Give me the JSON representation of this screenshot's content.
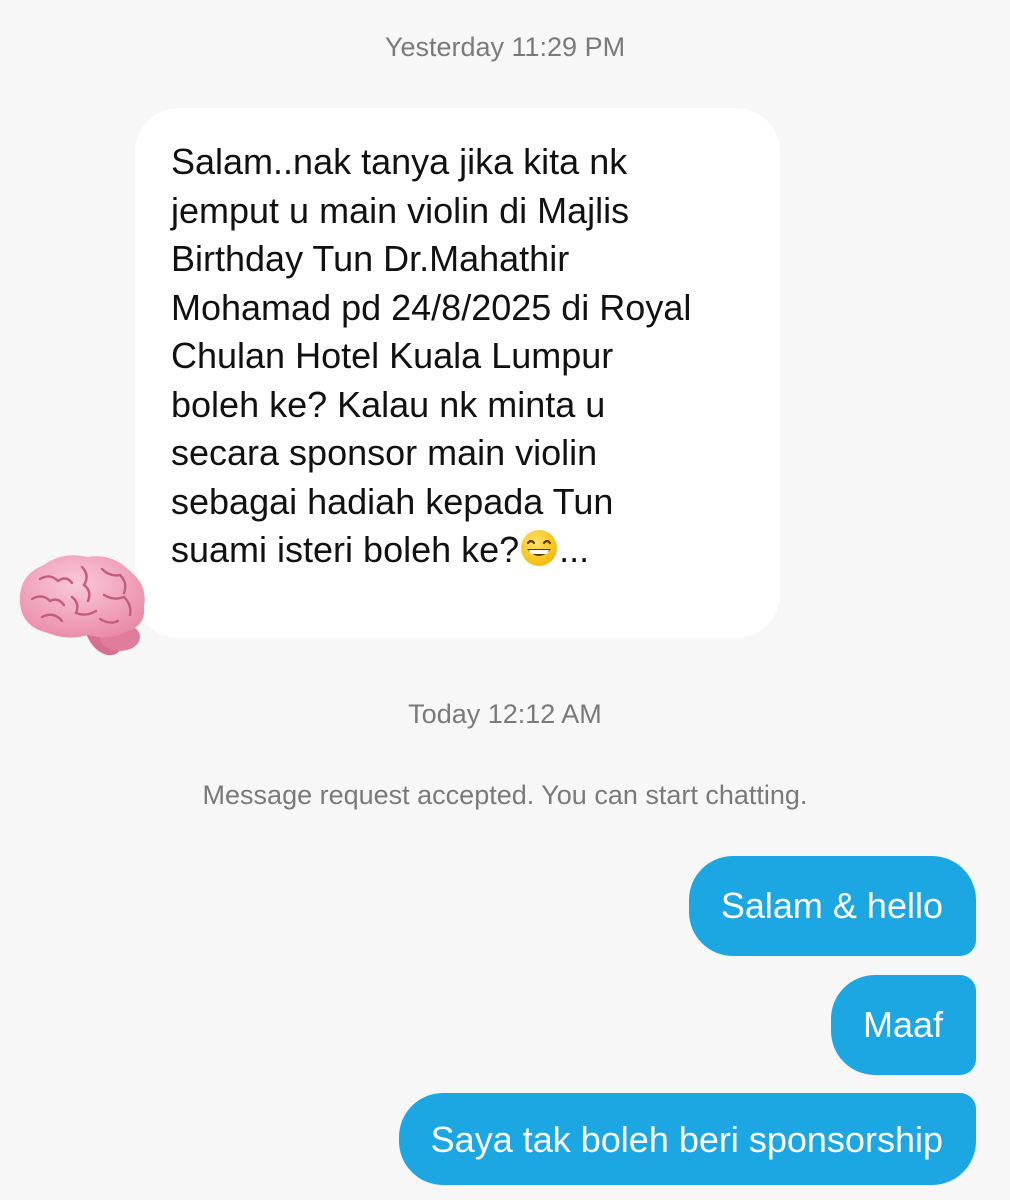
{
  "timestamps": {
    "first": "Yesterday 11:29 PM",
    "second": "Today 12:12 AM"
  },
  "incoming_message": {
    "lines": [
      "Salam..nak tanya jika kita nk",
      "jemput u main violin di Majlis",
      "Birthday Tun Dr.Mahathir",
      "Mohamad pd 24/8/2025 di Royal",
      "Chulan Hotel Kuala Lumpur",
      "boleh ke? Kalau nk minta u",
      "secara sponsor main violin",
      "sebagai hadiah kepada Tun",
      "suami isteri boleh ke?"
    ],
    "emoji": "grinning-face-with-smiling-eyes-emoji",
    "suffix": "...",
    "sender_avatar_icon": "brain-emoji-avatar"
  },
  "system_message": "Message request accepted. You can start chatting.",
  "outgoing_messages": [
    "Salam & hello",
    "Maaf",
    "Saya tak boleh beri sponsorship"
  ],
  "colors": {
    "background": "#f7f7f7",
    "incoming_bubble": "#ffffff",
    "outgoing_bubble": "#1ca7e3",
    "meta_text": "#7a7a7a"
  }
}
